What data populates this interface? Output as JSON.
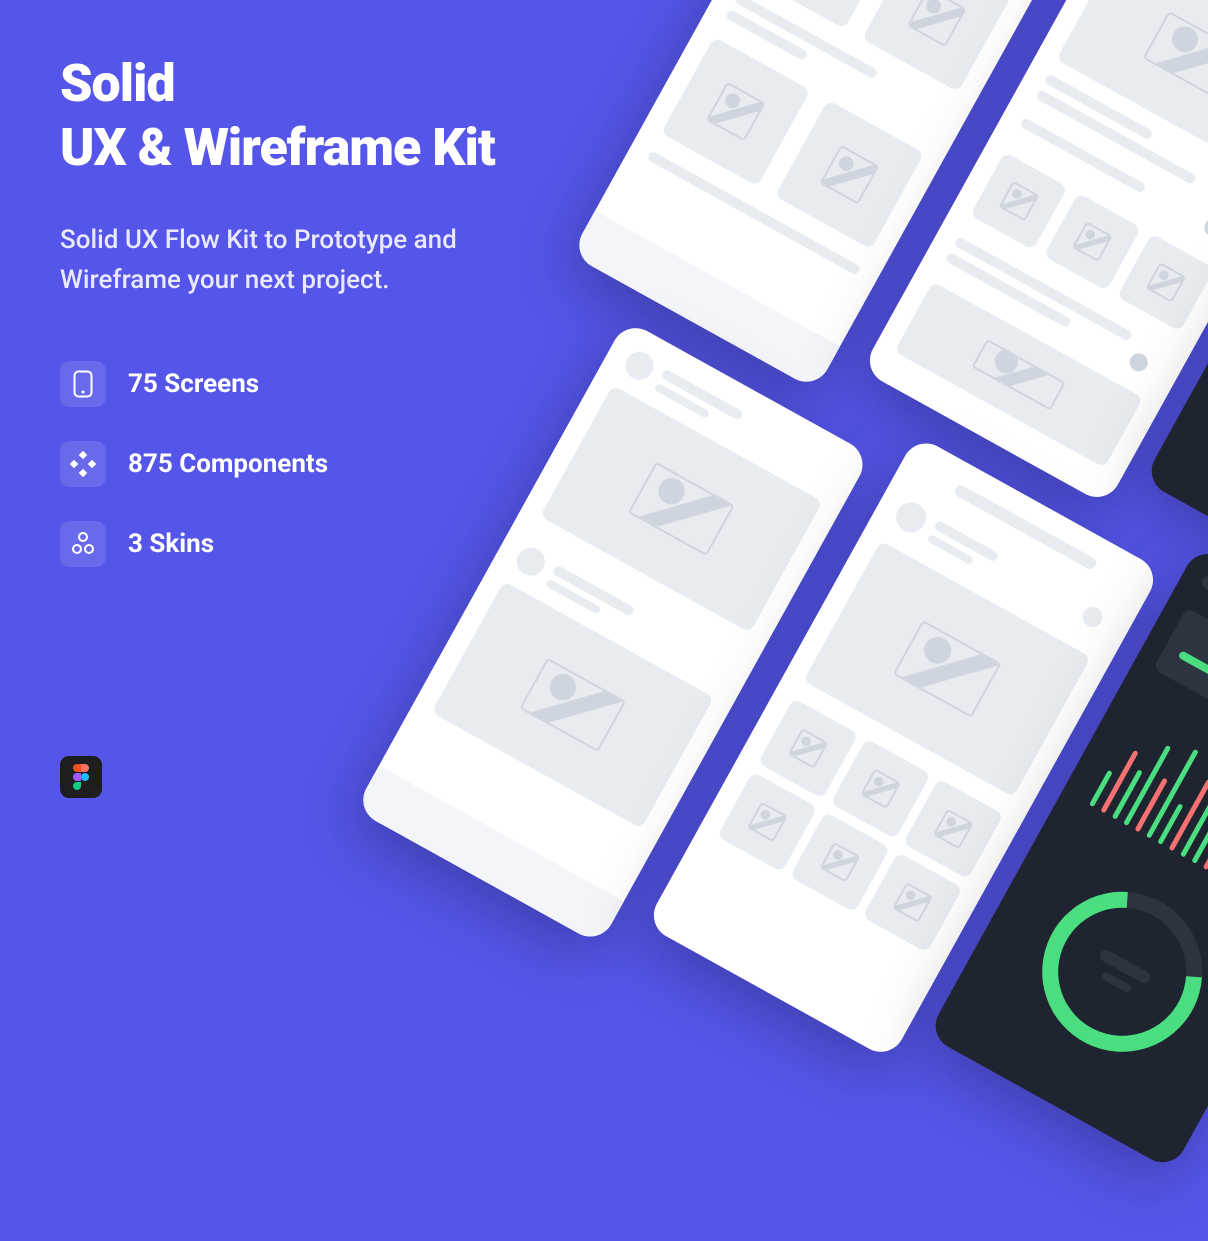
{
  "title": {
    "line1": "Solid",
    "line2": "UX & Wireframe Kit"
  },
  "subtitle": "Solid UX Flow Kit to Prototype and Wireframe your next project.",
  "features": [
    {
      "icon": "phone-icon",
      "label": "75 Screens"
    },
    {
      "icon": "components-icon",
      "label": "875 Components"
    },
    {
      "icon": "skins-icon",
      "label": "3 Skins"
    }
  ],
  "badge": "figma"
}
